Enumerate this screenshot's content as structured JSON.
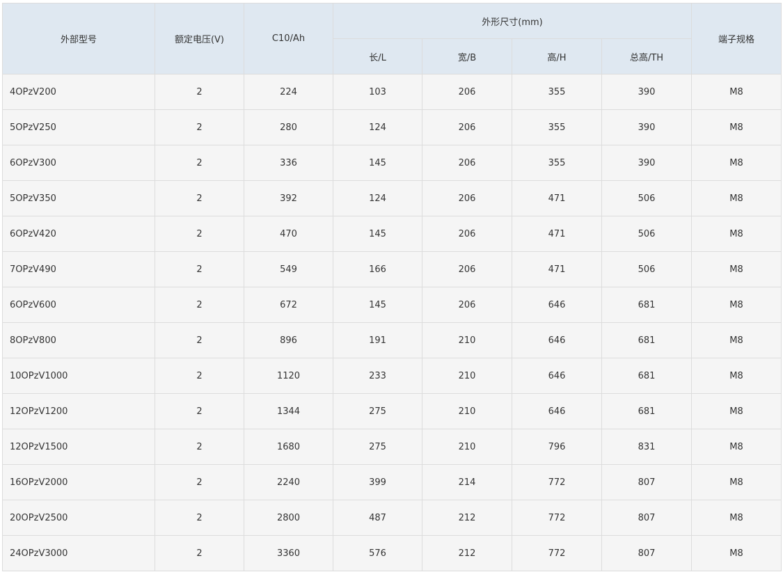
{
  "table": {
    "headers": {
      "model": "外部型号",
      "voltage": "额定电压(V)",
      "capacity": "C10/Ah",
      "dimensions_group": "外形尺寸(mm)",
      "length": "长/L",
      "width": "宽/B",
      "height": "高/H",
      "total_height": "总高/TH",
      "terminal": "端子规格"
    },
    "rows": [
      {
        "model": "4OPzV200",
        "voltage": "2",
        "capacity": "224",
        "length": "103",
        "width": "206",
        "height": "355",
        "total_height": "390",
        "terminal": "M8"
      },
      {
        "model": "5OPzV250",
        "voltage": "2",
        "capacity": "280",
        "length": "124",
        "width": "206",
        "height": "355",
        "total_height": "390",
        "terminal": "M8"
      },
      {
        "model": "6OPzV300",
        "voltage": "2",
        "capacity": "336",
        "length": "145",
        "width": "206",
        "height": "355",
        "total_height": "390",
        "terminal": "M8"
      },
      {
        "model": "5OPzV350",
        "voltage": "2",
        "capacity": "392",
        "length": "124",
        "width": "206",
        "height": "471",
        "total_height": "506",
        "terminal": "M8"
      },
      {
        "model": "6OPzV420",
        "voltage": "2",
        "capacity": "470",
        "length": "145",
        "width": "206",
        "height": "471",
        "total_height": "506",
        "terminal": "M8"
      },
      {
        "model": "7OPzV490",
        "voltage": "2",
        "capacity": "549",
        "length": "166",
        "width": "206",
        "height": "471",
        "total_height": "506",
        "terminal": "M8"
      },
      {
        "model": "6OPzV600",
        "voltage": "2",
        "capacity": "672",
        "length": "145",
        "width": "206",
        "height": "646",
        "total_height": "681",
        "terminal": "M8"
      },
      {
        "model": "8OPzV800",
        "voltage": "2",
        "capacity": "896",
        "length": "191",
        "width": "210",
        "height": "646",
        "total_height": "681",
        "terminal": "M8"
      },
      {
        "model": "10OPzV1000",
        "voltage": "2",
        "capacity": "1120",
        "length": "233",
        "width": "210",
        "height": "646",
        "total_height": "681",
        "terminal": "M8"
      },
      {
        "model": "12OPzV1200",
        "voltage": "2",
        "capacity": "1344",
        "length": "275",
        "width": "210",
        "height": "646",
        "total_height": "681",
        "terminal": "M8"
      },
      {
        "model": "12OPzV1500",
        "voltage": "2",
        "capacity": "1680",
        "length": "275",
        "width": "210",
        "height": "796",
        "total_height": "831",
        "terminal": "M8"
      },
      {
        "model": "16OPzV2000",
        "voltage": "2",
        "capacity": "2240",
        "length": "399",
        "width": "214",
        "height": "772",
        "total_height": "807",
        "terminal": "M8"
      },
      {
        "model": "20OPzV2500",
        "voltage": "2",
        "capacity": "2800",
        "length": "487",
        "width": "212",
        "height": "772",
        "total_height": "807",
        "terminal": "M8"
      },
      {
        "model": "24OPzV3000",
        "voltage": "2",
        "capacity": "3360",
        "length": "576",
        "width": "212",
        "height": "772",
        "total_height": "807",
        "terminal": "M8"
      }
    ]
  }
}
